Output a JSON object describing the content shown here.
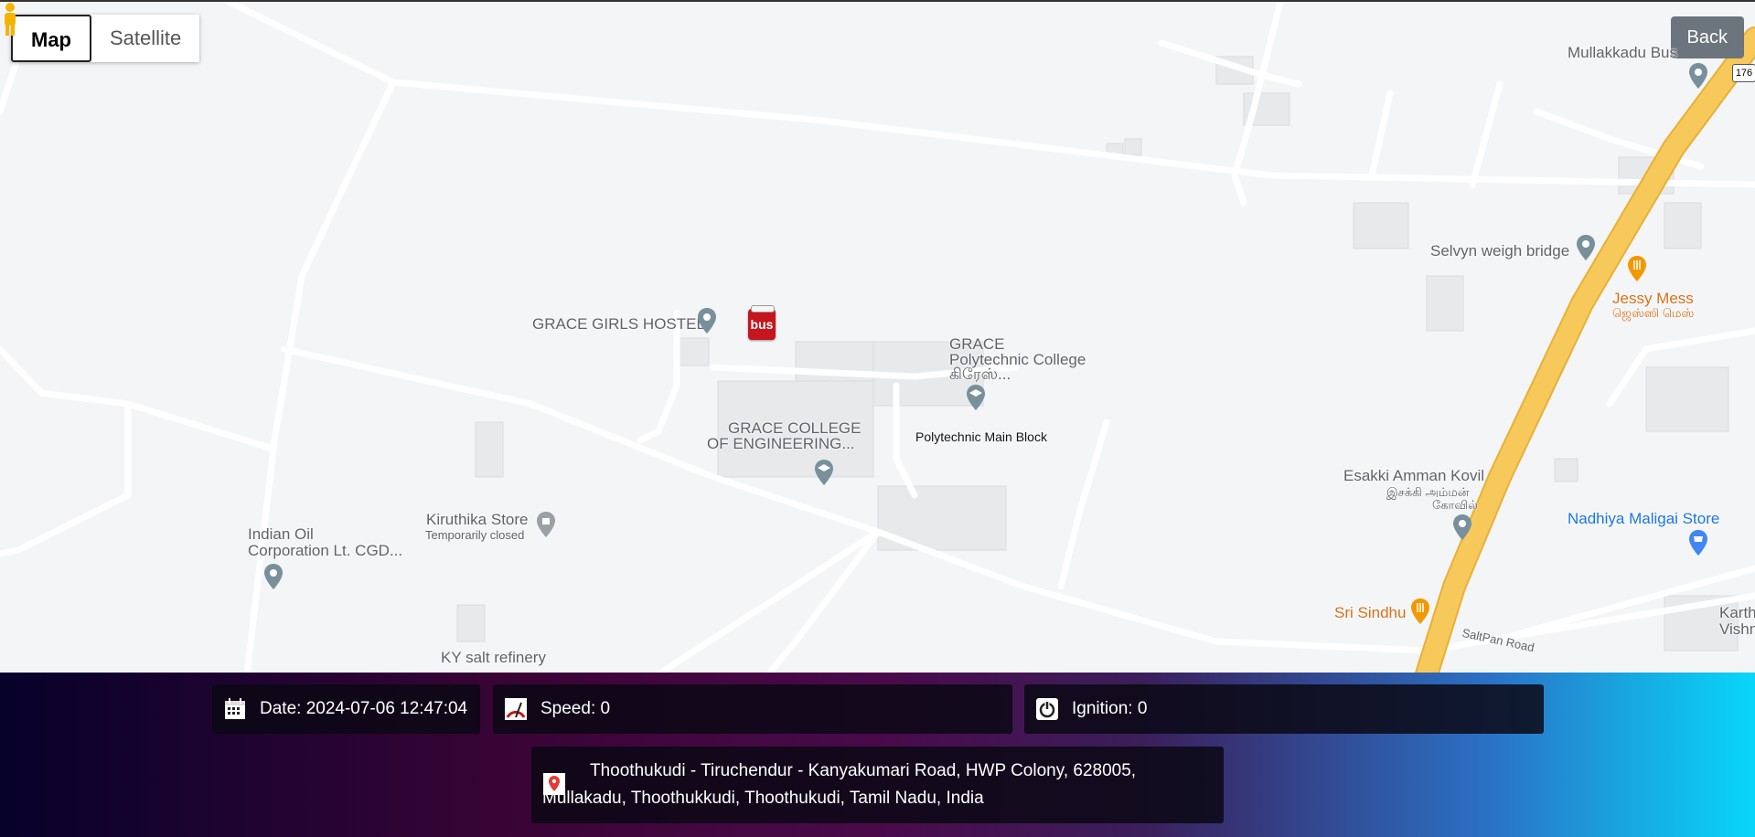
{
  "map_type": {
    "map_label": "Map",
    "satellite_label": "Satellite"
  },
  "back_label": "Back",
  "places": {
    "mullakkadu_bus": "Mullakkadu Bus",
    "route_shield": "176",
    "selvyn": "Selvyn weigh bridge",
    "jessy_mess": "Jessy Mess",
    "jessy_mess_tamil": "ஜெஸ்ஸி மெஸ்",
    "grace_hostel": "GRACE GIRLS HOSTEL",
    "grace_poly_1": "GRACE",
    "grace_poly_2": "Polytechnic College",
    "grace_poly_3": "கிரேஸ்...",
    "grace_eng_1": "GRACE COLLEGE",
    "grace_eng_2": "OF ENGINEERING...",
    "poly_main": "Polytechnic Main Block",
    "esakki_1": "Esakki Amman Kovil",
    "esakki_2": "இசக்கி அம்மன்",
    "esakki_3": "கோவில்",
    "nadhiya": "Nadhiya Maligai Store",
    "kiruthika": "Kiruthika Store",
    "kiruthika_status": "Temporarily closed",
    "indian_oil_1": "Indian Oil",
    "indian_oil_2": "Corporation Lt. CGD...",
    "sri_sindhu": "Sri Sindhu",
    "saltpan": "SaltPan Road",
    "karth_1": "Karth",
    "karth_2": "Vishn",
    "ky_salt": "KY salt refinery",
    "bus_marker": "bus"
  },
  "info": {
    "date_label": "Date: 2024-07-06 12:47:04",
    "speed_label": "Speed: 0",
    "ignition_label": "Ignition: 0",
    "address_line1": "Thoothukudi - Tiruchendur - Kanyakumari Road, HWP Colony, 628005,",
    "address_line2": "Mullakadu, Thoothukkudi, Thoothukudi, Tamil Nadu, India"
  },
  "colors": {
    "highway": "#f7c85a",
    "road": "#ffffff",
    "panel_left": "#07022b",
    "panel_right": "#08d7f9"
  }
}
